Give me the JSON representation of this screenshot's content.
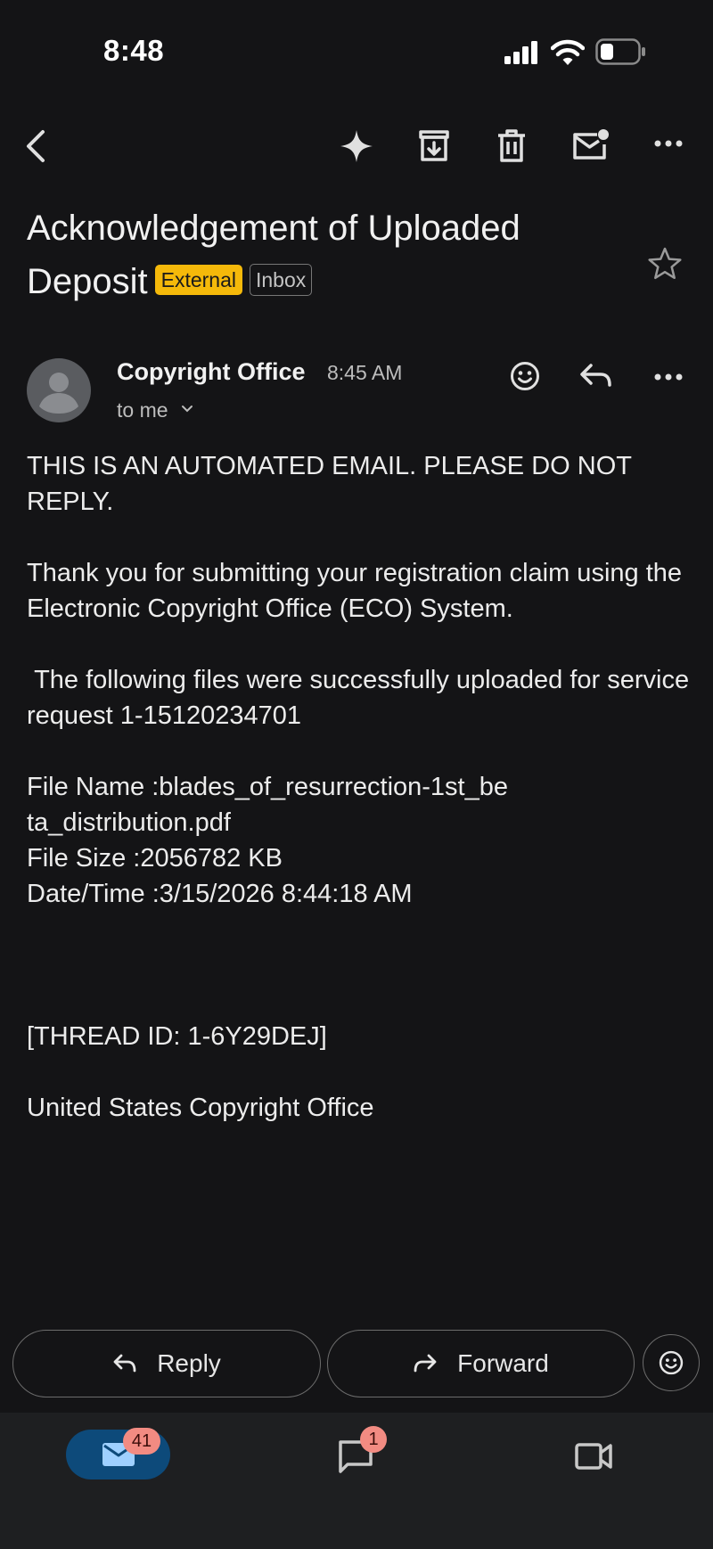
{
  "status_bar": {
    "time": "8:48"
  },
  "toolbar": {
    "back_icon": "chevron-left-icon",
    "icons": [
      "sparkle-icon",
      "archive-icon",
      "trash-icon",
      "mark-unread-icon",
      "more-horizontal-icon"
    ]
  },
  "email": {
    "subject": "Acknowledgement of Uploaded Deposit",
    "labels": {
      "external": "External",
      "inbox": "Inbox"
    },
    "sender": "Copyright Office",
    "time": "8:45 AM",
    "recipient": "to me",
    "body": {
      "line1": "THIS IS AN AUTOMATED EMAIL. PLEASE DO NOT REPLY.",
      "para2": "Thank you for submitting your registration claim using the Electronic Copyright Office (ECO) System.",
      "para3": " The following files were successfully uploaded for service request 1-15120234701",
      "file_name": "File Name :blades_of_resurrection-1st_be\nta_distribution.pdf",
      "file_size": "File Size :2056782 KB",
      "date_time": "Date/Time :3/15/2026 8:44:18 AM",
      "thread_id": "[THREAD ID: 1-6Y29DEJ]",
      "signature": "United States Copyright Office"
    }
  },
  "actions": {
    "reply": "Reply",
    "forward": "Forward"
  },
  "nav": {
    "mail_badge": "41",
    "chat_badge": "1"
  },
  "colors": {
    "background": "#141416",
    "external_tag": "#f5b90a",
    "mail_pill": "#0d4a7a",
    "badge": "#f28b82"
  }
}
